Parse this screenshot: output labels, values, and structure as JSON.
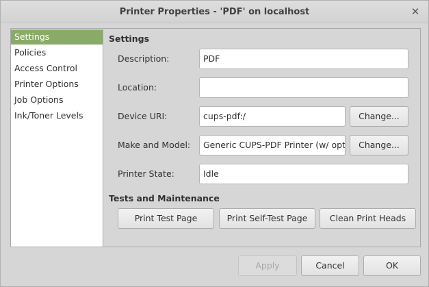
{
  "window": {
    "title": "Printer Properties - 'PDF' on localhost"
  },
  "sidebar": {
    "items": [
      {
        "label": "Settings",
        "selected": true
      },
      {
        "label": "Policies",
        "selected": false
      },
      {
        "label": "Access Control",
        "selected": false
      },
      {
        "label": "Printer Options",
        "selected": false
      },
      {
        "label": "Job Options",
        "selected": false
      },
      {
        "label": "Ink/Toner Levels",
        "selected": false
      }
    ]
  },
  "settings": {
    "heading": "Settings",
    "description": {
      "label": "Description:",
      "value": "PDF"
    },
    "location": {
      "label": "Location:",
      "value": ""
    },
    "device_uri": {
      "label": "Device URI:",
      "value": "cups-pdf:/",
      "change_label": "Change..."
    },
    "make_model": {
      "label": "Make and Model:",
      "value": "Generic CUPS-PDF Printer (w/ options)",
      "change_label": "Change..."
    },
    "printer_state": {
      "label": "Printer State:",
      "value": "Idle"
    }
  },
  "maintenance": {
    "heading": "Tests and Maintenance",
    "print_test_page": "Print Test Page",
    "print_self_test_page": "Print Self-Test Page",
    "clean_print_heads": "Clean Print Heads"
  },
  "footer": {
    "apply": "Apply",
    "cancel": "Cancel",
    "ok": "OK"
  },
  "colors": {
    "selection": "#8aab67",
    "window_bg": "#d6d6d6"
  }
}
